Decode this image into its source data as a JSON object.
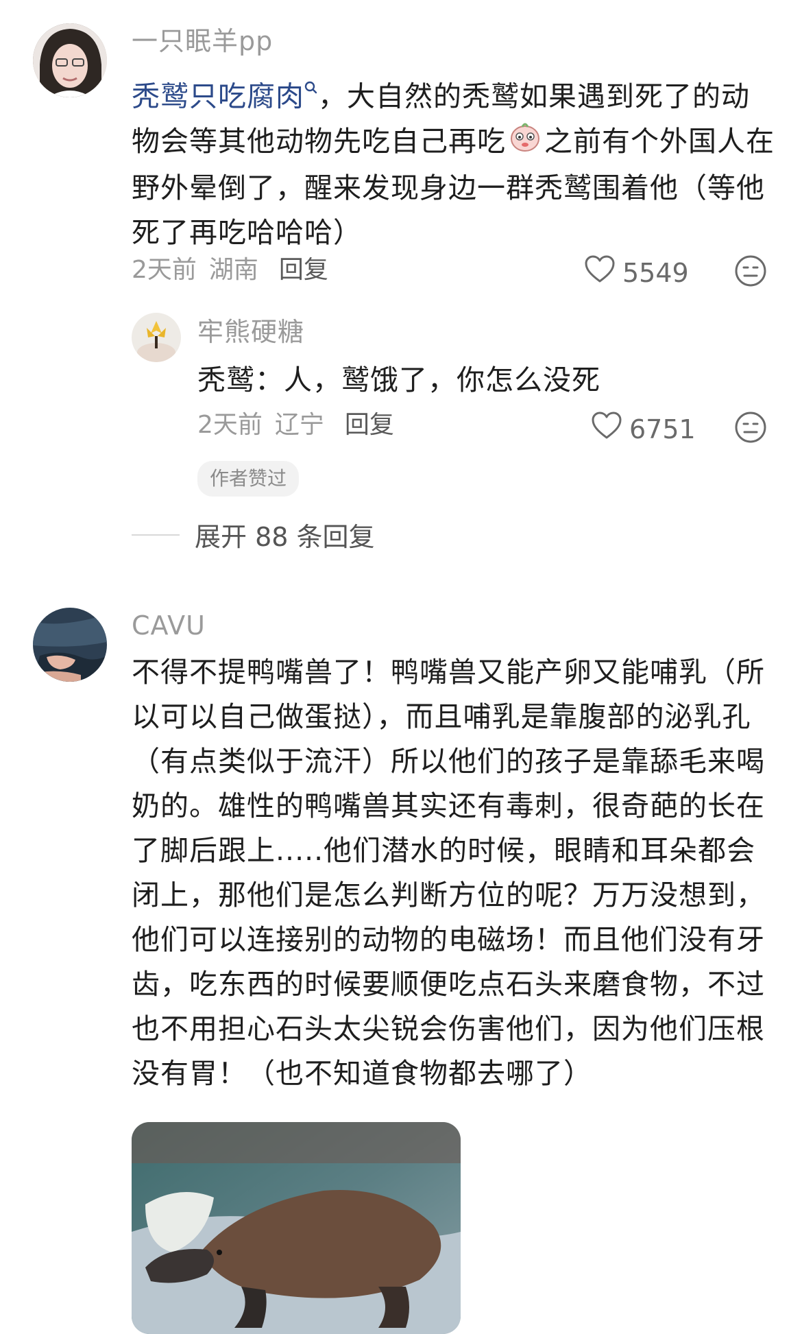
{
  "comment1": {
    "username": "一只眠羊pp",
    "link_text": "秃鹫只吃腐肉",
    "lines": [
      "，大自然的秃鹫如果遇到死了的动",
      "物会等其他动物先吃自己再吃",
      "之前有个外国人在",
      "野外晕倒了，醒来发现身边一群秃鹫围着他（等他",
      "死了再吃哈哈哈）"
    ],
    "time": "2天前",
    "location": "湖南",
    "reply_label": "回复",
    "likes": "5549",
    "reply": {
      "username": "牢熊硬糖",
      "text": "秃鹫：人，鹫饿了，你怎么没死",
      "time": "2天前",
      "location": "辽宁",
      "reply_label": "回复",
      "likes": "6751",
      "badge": "作者赞过"
    },
    "expand_label": "展开 88 条回复"
  },
  "comment2": {
    "username": "CAVU",
    "lines": [
      "不得不提鸭嘴兽了！鸭嘴兽又能产卵又能哺乳（所",
      "以可以自己做蛋挞），而且哺乳是靠腹部的泌乳孔",
      "（有点类似于流汗）所以他们的孩子是靠舔毛来喝",
      "奶的。雄性的鸭嘴兽其实还有毒刺，很奇葩的长在",
      "了脚后跟上.....他们潜水的时候，眼睛和耳朵都会",
      "闭上，那他们是怎么判断方位的呢？万万没想到，",
      "他们可以连接别的动物的电磁场！而且他们没有牙",
      "齿，吃东西的时候要顺便吃点石头来磨食物，不过",
      "也不用担心石头太尖锐会伤害他们，因为他们压根",
      "没有胃！（也不知道食物都去哪了）"
    ]
  },
  "icons": {
    "heart": "heart-icon",
    "dislike": "dislike-face-icon",
    "search": "search-icon",
    "emoji": "sad-emoji-icon"
  },
  "colors": {
    "link": "#2c4a8a",
    "muted": "#9a9a9a"
  }
}
